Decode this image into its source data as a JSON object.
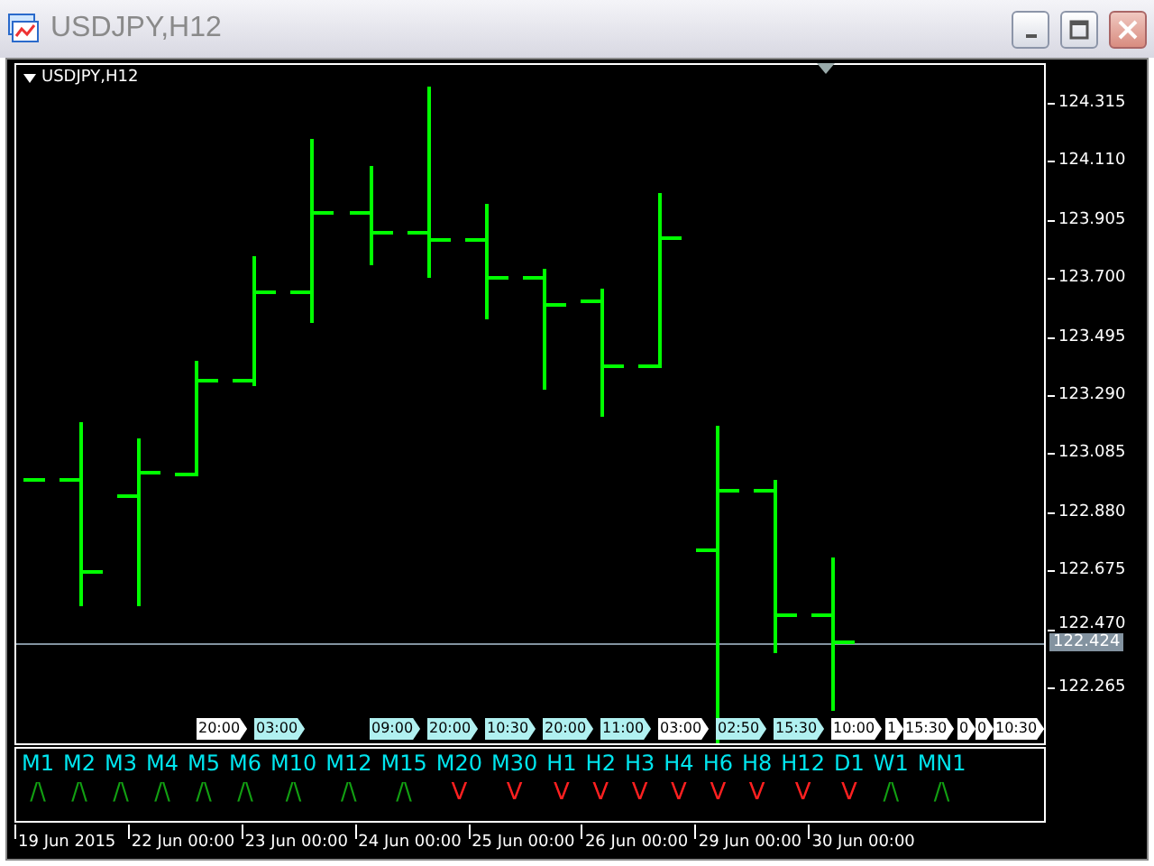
{
  "window": {
    "title": "USDJPY,H12"
  },
  "chart": {
    "label": "USDJPY,H12",
    "price_labels": [
      "124.315",
      "124.110",
      "123.905",
      "123.700",
      "123.495",
      "123.290",
      "123.085",
      "122.880",
      "122.675",
      "122.470",
      "122.265"
    ],
    "bid_price": "122.424",
    "time_tags": [
      {
        "label": "20:00",
        "color": "#ffffff"
      },
      {
        "label": "03:00",
        "color": "#b0f0f0"
      },
      {
        "label": "09:00",
        "color": "#b0f0f0"
      },
      {
        "label": "20:00",
        "color": "#b0f0f0"
      },
      {
        "label": "10:30",
        "color": "#b0f0f0"
      },
      {
        "label": "20:00",
        "color": "#b0f0f0"
      },
      {
        "label": "11:00",
        "color": "#b0f0f0"
      },
      {
        "label": "03:00",
        "color": "#ffffff"
      },
      {
        "label": "02:50",
        "color": "#b0f0f0"
      },
      {
        "label": "15:30",
        "color": "#b0f0f0"
      },
      {
        "label": "10:00",
        "color": "#ffffff"
      },
      {
        "label": "1",
        "color": "#ffffff"
      },
      {
        "label": "15:30",
        "color": "#ffffff"
      },
      {
        "label": "0",
        "color": "#ffffff"
      },
      {
        "label": "0",
        "color": "#ffffff"
      },
      {
        "label": "10:30",
        "color": "#ffffff"
      }
    ]
  },
  "indicator": [
    {
      "label": "M1",
      "arrow": "/\\",
      "up": true
    },
    {
      "label": "M2",
      "arrow": "/\\",
      "up": true
    },
    {
      "label": "M3",
      "arrow": "/\\",
      "up": true
    },
    {
      "label": "M4",
      "arrow": "/\\",
      "up": true
    },
    {
      "label": "M5",
      "arrow": "/\\",
      "up": true
    },
    {
      "label": "M6",
      "arrow": "/\\",
      "up": true
    },
    {
      "label": "M10",
      "arrow": "/\\",
      "up": true
    },
    {
      "label": "M12",
      "arrow": "/\\",
      "up": true
    },
    {
      "label": "M15",
      "arrow": "/\\",
      "up": true
    },
    {
      "label": "M20",
      "arrow": "V",
      "up": false
    },
    {
      "label": "M30",
      "arrow": "V",
      "up": false
    },
    {
      "label": "H1",
      "arrow": "V",
      "up": false
    },
    {
      "label": "H2",
      "arrow": "V",
      "up": false
    },
    {
      "label": "H3",
      "arrow": "V",
      "up": false
    },
    {
      "label": "H4",
      "arrow": "V",
      "up": false
    },
    {
      "label": "H6",
      "arrow": "V",
      "up": false
    },
    {
      "label": "H8",
      "arrow": "V",
      "up": false
    },
    {
      "label": "H12",
      "arrow": "V",
      "up": false
    },
    {
      "label": "D1",
      "arrow": "V",
      "up": false
    },
    {
      "label": "W1",
      "arrow": "/\\",
      "up": true
    },
    {
      "label": "MN1",
      "arrow": "/\\",
      "up": true
    }
  ],
  "time_axis": [
    "19 Jun 2015",
    "22 Jun 00:00",
    "23 Jun 00:00",
    "24 Jun 00:00",
    "25 Jun 00:00",
    "26 Jun 00:00",
    "29 Jun 00:00",
    "30 Jun 00:00"
  ]
}
